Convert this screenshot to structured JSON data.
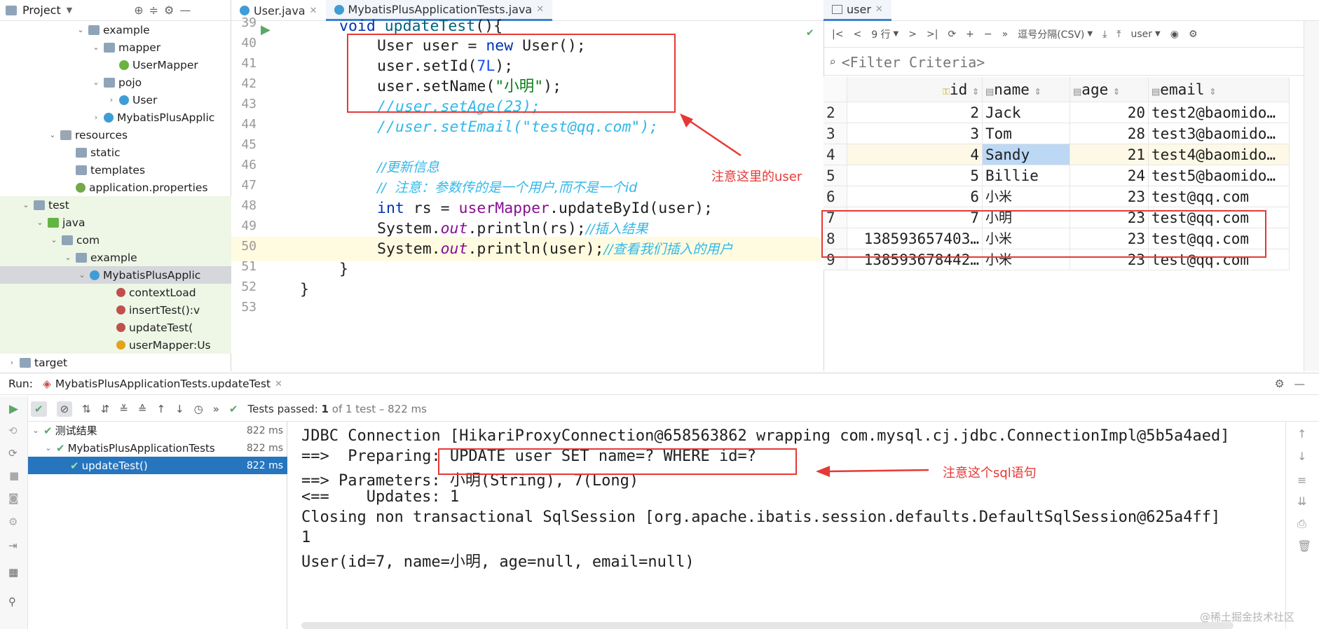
{
  "project_panel": {
    "title": "Project",
    "tree": [
      {
        "label": "example",
        "icon": "folder-icon"
      },
      {
        "label": "mapper",
        "icon": "folder-icon"
      },
      {
        "label": "UserMapper",
        "icon": "interface-icon"
      },
      {
        "label": "pojo",
        "icon": "folder-icon"
      },
      {
        "label": "User",
        "icon": "class-icon"
      },
      {
        "label": "MybatisPlusApplic",
        "icon": "class-icon"
      },
      {
        "label": "resources",
        "icon": "resources-folder-icon"
      },
      {
        "label": "static",
        "icon": "folder-icon"
      },
      {
        "label": "templates",
        "icon": "folder-icon"
      },
      {
        "label": "application.properties",
        "icon": "properties-file-icon"
      },
      {
        "label": "test",
        "icon": "folder-icon"
      },
      {
        "label": "java",
        "icon": "test-folder-icon"
      },
      {
        "label": "com",
        "icon": "folder-icon"
      },
      {
        "label": "example",
        "icon": "folder-icon"
      },
      {
        "label": "MybatisPlusApplic",
        "icon": "class-icon"
      },
      {
        "label": "contextLoad",
        "icon": "method-icon"
      },
      {
        "label": "insertTest():v",
        "icon": "method-icon"
      },
      {
        "label": "updateTest(",
        "icon": "method-icon"
      },
      {
        "label": "userMapper:Us",
        "icon": "field-icon"
      },
      {
        "label": "target",
        "icon": "folder-icon"
      }
    ]
  },
  "editor": {
    "tabs": [
      {
        "label": "User.java",
        "active": false
      },
      {
        "label": "MybatisPlusApplicationTests.java",
        "active": true
      }
    ],
    "line_numbers": [
      "39",
      "40",
      "41",
      "42",
      "43",
      "44",
      "45",
      "46",
      "47",
      "48",
      "49",
      "50",
      "51",
      "52",
      "53"
    ]
  },
  "db_panel": {
    "tab_label": "user",
    "rows_label": "9 行",
    "format_label": "逗号分隔(CSV)",
    "schema_label": "user",
    "filter_placeholder": "<Filter Criteria>",
    "columns": [
      "id",
      "name",
      "age",
      "email"
    ],
    "rows": [
      {
        "n": "2",
        "id": "2",
        "name": "Jack",
        "age": "20",
        "email": "test2@baomido…"
      },
      {
        "n": "3",
        "id": "3",
        "name": "Tom",
        "age": "28",
        "email": "test3@baomido…"
      },
      {
        "n": "4",
        "id": "4",
        "name": "Sandy",
        "age": "21",
        "email": "test4@baomido…"
      },
      {
        "n": "5",
        "id": "5",
        "name": "Billie",
        "age": "24",
        "email": "test5@baomido…"
      },
      {
        "n": "6",
        "id": "6",
        "name": "小米",
        "age": "23",
        "email": "test@qq.com"
      },
      {
        "n": "7",
        "id": "7",
        "name": "小明",
        "age": "23",
        "email": "test@qq.com"
      },
      {
        "n": "8",
        "id": "138593657403…",
        "name": "小米",
        "age": "23",
        "email": "test@qq.com"
      },
      {
        "n": "9",
        "id": "138593678442…",
        "name": "小米",
        "age": "23",
        "email": "test@qq.com"
      }
    ]
  },
  "annotations": {
    "user_note": "注意这里的user",
    "sql_note": "注意这个sql语句"
  },
  "run_panel": {
    "run_label": "Run:",
    "run_config": "MybatisPlusApplicationTests.updateTest",
    "tests_passed": "Tests passed:",
    "tests_count": "1",
    "tests_detail": "of 1 test – 822 ms",
    "tree": [
      {
        "label": "测试结果",
        "time": "822 ms"
      },
      {
        "label": "MybatisPlusApplicationTests",
        "time": "822 ms"
      },
      {
        "label": "updateTest()",
        "time": "822 ms"
      }
    ],
    "console": [
      "JDBC Connection [HikariProxyConnection@658563862 wrapping com.mysql.cj.jdbc.ConnectionImpl@5b5a4aed]",
      "==>  Preparing: UPDATE user SET name=? WHERE id=?",
      "==> Parameters: 小明(String), 7(Long)",
      "<==    Updates: 1",
      "Closing non transactional SqlSession [org.apache.ibatis.session.defaults.DefaultSqlSession@625a4ff]",
      "1",
      "User(id=7, name=小明, age=null, email=null)"
    ]
  },
  "watermark": "@稀土掘金技术社区"
}
